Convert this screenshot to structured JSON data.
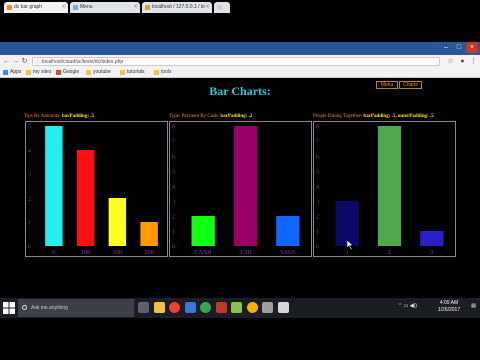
{
  "browser": {
    "tabs": [
      {
        "label": "dc bar graph",
        "icon": "page-icon",
        "color": "#f28c28",
        "active": true
      },
      {
        "label": "Menu",
        "icon": "page-icon",
        "color": "#8aa4d6",
        "active": false
      },
      {
        "label": "localhost / 127.0.0.1 / lo",
        "icon": "database-icon",
        "color": "#e39a3b",
        "active": false
      },
      {
        "label": "",
        "icon": "page-icon",
        "color": "#cfcfcf",
        "active": false
      }
    ],
    "address": "localhost/cloud/sc/tests/dc/index.php",
    "bookmarks": [
      {
        "label": "Apps",
        "color": "#4285f4"
      },
      {
        "label": "my sites",
        "color": "#f5c342"
      },
      {
        "label": "Google",
        "color": "#ea4335"
      },
      {
        "label": "youtube",
        "color": "#f5c342"
      },
      {
        "label": "tutorials",
        "color": "#f5c342"
      },
      {
        "label": "tools",
        "color": "#f5c342"
      }
    ]
  },
  "page": {
    "title": "Bar Charts:",
    "nav": {
      "menu": "Menu",
      "charts": "Charts"
    }
  },
  "chart_data": [
    {
      "type": "bar",
      "title_prefix": "Tips By Amounts- ",
      "title_highlight": "barPadding: .5",
      "categories": [
        "0",
        "100",
        "150",
        "200"
      ],
      "values": [
        5,
        4,
        2,
        1
      ],
      "colors": [
        "#22eeee",
        "#ff1010",
        "#ffff22",
        "#ff9900"
      ],
      "ylim": [
        0,
        5
      ],
      "yticks": [
        0,
        1,
        2,
        3,
        4,
        5
      ]
    },
    {
      "type": "bar",
      "title_prefix": "Type: Payment By Cash- ",
      "title_highlight": "barPadding: .2",
      "categories": [
        "CASH",
        "TAB",
        "VISA"
      ],
      "values": [
        2,
        8,
        2
      ],
      "colors": [
        "#11ff11",
        "#990066",
        "#1166ff"
      ],
      "ylim": [
        0,
        8
      ],
      "yticks": [
        0,
        1,
        2,
        3,
        4,
        5,
        6,
        7,
        8
      ]
    },
    {
      "type": "bar",
      "title_prefix": "People Dining Together- ",
      "title_highlight": "barPadding: .5, outerPadding: .5",
      "categories": [
        "1",
        "2",
        "3"
      ],
      "values": [
        3,
        8,
        1
      ],
      "colors": [
        "#0a0a66",
        "#4ea84e",
        "#2a1ec8"
      ],
      "ylim": [
        0,
        8
      ],
      "yticks": [
        0,
        1,
        2,
        3,
        4,
        5,
        6,
        7,
        8
      ]
    }
  ],
  "taskbar": {
    "search_placeholder": "Ask me anything",
    "time": "4:09 AM",
    "date": "1/26/2017",
    "apps": [
      {
        "icon": "task-view-icon",
        "color": "#5a6070"
      },
      {
        "icon": "folder-icon",
        "color": "#f0c040"
      },
      {
        "icon": "chrome-icon",
        "color": "#ea4335"
      },
      {
        "icon": "edge-icon",
        "color": "#3a78d8"
      },
      {
        "icon": "chrome-alt-icon",
        "color": "#34a853"
      },
      {
        "icon": "filezilla-icon",
        "color": "#c0392b"
      },
      {
        "icon": "notepad-icon",
        "color": "#8bc34a"
      },
      {
        "icon": "chrome-canary-icon",
        "color": "#f5b400"
      },
      {
        "icon": "settings-icon",
        "color": "#9e9e9e"
      },
      {
        "icon": "app-icon",
        "color": "#cfd8dc"
      }
    ]
  }
}
